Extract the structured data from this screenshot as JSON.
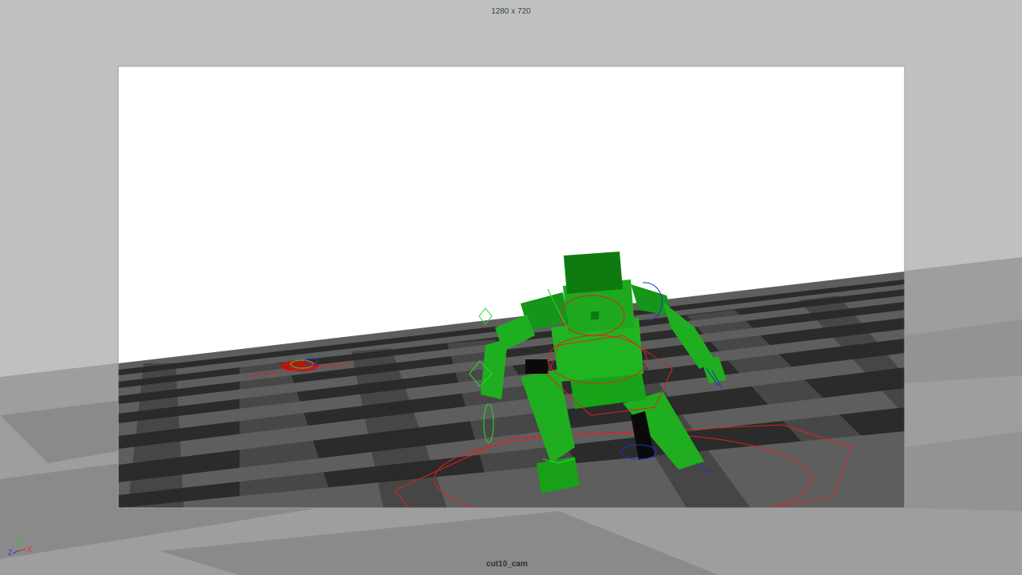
{
  "viewport": {
    "resolution_label": "1280 x 720",
    "camera_name": "cut10_cam"
  },
  "axis_gizmo": {
    "x_label": "X",
    "y_label": "Y",
    "z_label": "Z",
    "x_color": "#e03030",
    "y_color": "#30c030",
    "z_color": "#3030e0"
  },
  "colors": {
    "background_gray": "#c0c0c0",
    "sky": "#ffffff",
    "floor_light": "#6a6a6a",
    "floor_dark": "#2c2c2c",
    "character_green": "#1fb01f",
    "character_dark_green": "#0f7a0f",
    "control_red": "#e02020",
    "control_blue": "#2030d0",
    "control_green": "#20e020"
  },
  "scene": {
    "character": "green-blocky-robot",
    "background_character": "small-red-figure-lying-on-floor"
  }
}
